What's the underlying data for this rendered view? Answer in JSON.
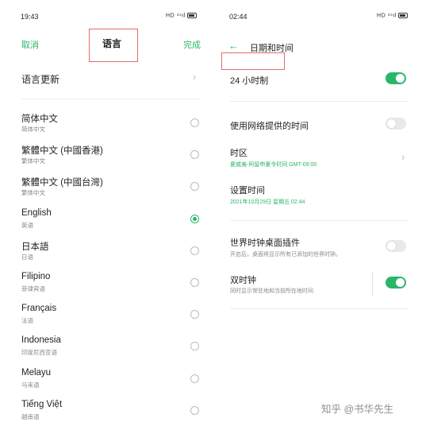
{
  "left": {
    "status": {
      "time": "19:43",
      "icons": "HD ⁴⁶ıl"
    },
    "header": {
      "cancel": "取消",
      "title": "语言",
      "done": "完成"
    },
    "update": {
      "label": "语言更新"
    },
    "languages": [
      {
        "name": "简体中文",
        "sub": "简体中文",
        "selected": false
      },
      {
        "name": "繁體中文 (中國香港)",
        "sub": "繁体中文",
        "selected": false
      },
      {
        "name": "繁體中文 (中國台灣)",
        "sub": "繁体中文",
        "selected": false
      },
      {
        "name": "English",
        "sub": "英语",
        "selected": true
      },
      {
        "name": "日本語",
        "sub": "日语",
        "selected": false
      },
      {
        "name": "Filipino",
        "sub": "菲律宾语",
        "selected": false
      },
      {
        "name": "Français",
        "sub": "法语",
        "selected": false
      },
      {
        "name": "Indonesia",
        "sub": "印度尼西亚语",
        "selected": false
      },
      {
        "name": "Melayu",
        "sub": "马来语",
        "selected": false
      },
      {
        "name": "Tiếng Việt",
        "sub": "越南语",
        "selected": false
      }
    ]
  },
  "right": {
    "status": {
      "time": "02:44",
      "icons": "HD ⁴⁶ıl"
    },
    "title": "日期和时间",
    "clock24": {
      "label": "24 小时制",
      "on": true
    },
    "network_time": {
      "label": "使用网络提供的时间",
      "on": false
    },
    "timezone": {
      "label": "时区",
      "value": "夏威夷-阿留申夏令时间 GMT-09:00"
    },
    "set_time": {
      "label": "设置时间",
      "value": "2021年10月29日 星期五 02:44"
    },
    "world_clock": {
      "label": "世界时钟桌面插件",
      "desc": "开启后，桌面将显示所有已添加的世界时钟。",
      "on": false
    },
    "dual_clock": {
      "label": "双时钟",
      "desc": "同时显示常驻地和当前所在地时间",
      "on": true
    }
  },
  "watermark": "知乎 @书华先生",
  "colors": {
    "accent": "#2bb56a",
    "highlight_box": "#e46b6b"
  }
}
